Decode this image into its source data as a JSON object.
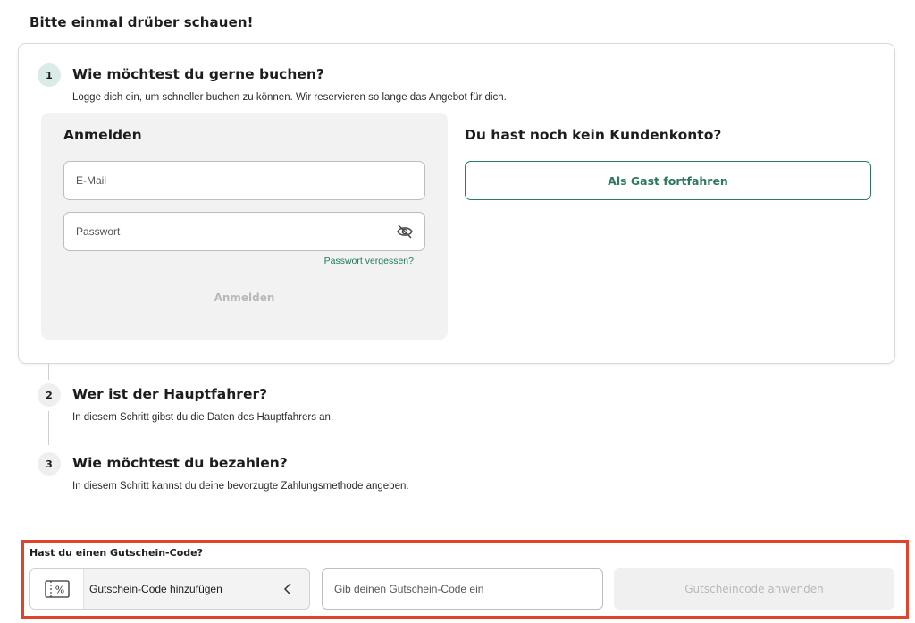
{
  "page": {
    "heading": "Bitte einmal drüber schauen!"
  },
  "steps": [
    {
      "number": "1",
      "title": "Wie möchtest du gerne buchen?",
      "description": "Logge dich ein, um schneller buchen zu können. Wir reservieren so lange das Angebot für dich."
    },
    {
      "number": "2",
      "title": "Wer ist der Hauptfahrer?",
      "description": "In diesem Schritt gibst du die Daten des Hauptfahrers an."
    },
    {
      "number": "3",
      "title": "Wie möchtest du bezahlen?",
      "description": "In diesem Schritt kannst du deine bevorzugte Zahlungsmethode angeben."
    }
  ],
  "login": {
    "title": "Anmelden",
    "email_placeholder": "E-Mail",
    "password_placeholder": "Passwort",
    "password_toggle_icon": "eye-slash-icon",
    "forgot_label": "Passwort vergessen?",
    "submit_label": "Anmelden"
  },
  "guest": {
    "title": "Du hast noch kein Kundenkonto?",
    "button_label": "Als Gast fortfahren"
  },
  "voucher": {
    "heading": "Hast du einen Gutschein-Code?",
    "toggle_label": "Gutschein-Code hinzufügen",
    "toggle_icon": "voucher-percent-icon",
    "input_placeholder": "Gib deinen Gutschein-Code ein",
    "apply_label": "Gutscheincode anwenden"
  },
  "colors": {
    "accent": "#2a7a5c",
    "highlight_border": "#e0452b",
    "active_badge": "#d9ece8"
  }
}
